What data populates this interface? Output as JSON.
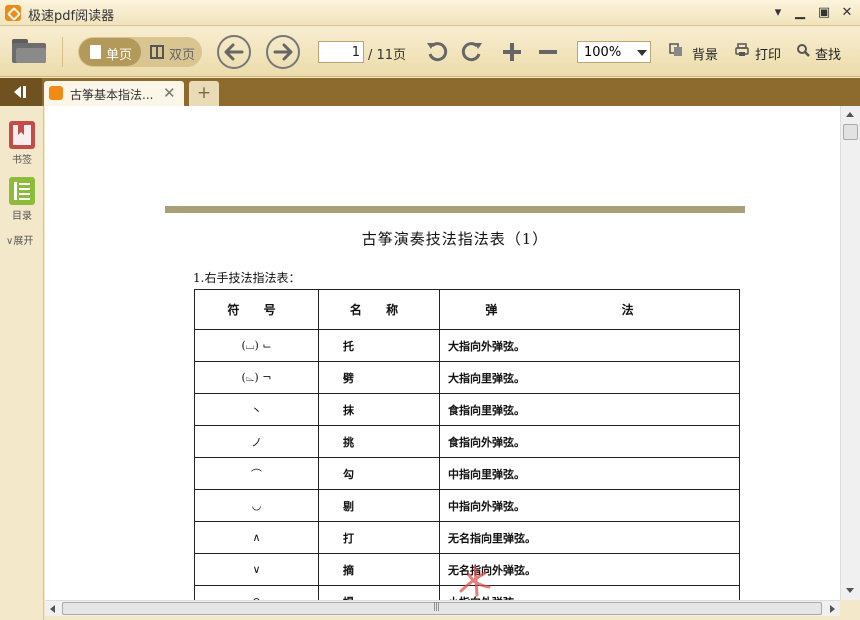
{
  "window": {
    "title": "极速pdf阅读器"
  },
  "toolbar": {
    "single_page_label": "单页",
    "double_page_label": "双页",
    "current_page": "1",
    "page_total": "/ 11页",
    "zoom": "100%",
    "background_label": "背景",
    "print_label": "打印",
    "find_label": "查找"
  },
  "tabs": [
    {
      "label": "古筝基本指法..."
    }
  ],
  "sidebar": {
    "bookmarks_label": "书签",
    "toc_label": "目录",
    "expand_label": "展开"
  },
  "document": {
    "title": "古筝演奏技法指法表（1）",
    "subtitle": "1.右手技法指法表：",
    "table": {
      "headers": [
        "符 号",
        "名 称",
        "弹 法"
      ],
      "rows": [
        {
          "symbol": "(⌴) ⌙",
          "name": "托",
          "method": "大指向外弹弦。"
        },
        {
          "symbol": "(⌳) ¬",
          "name": "劈",
          "method": "大指向里弹弦。"
        },
        {
          "symbol": "丶",
          "name": "抹",
          "method": "食指向里弹弦。"
        },
        {
          "symbol": "ノ",
          "name": "挑",
          "method": "食指向外弹弦。"
        },
        {
          "symbol": "⌒",
          "name": "勾",
          "method": "中指向里弹弦。"
        },
        {
          "symbol": "◡",
          "name": "剔",
          "method": "中指向外弹弦。"
        },
        {
          "symbol": "∧",
          "name": "打",
          "method": "无名指向里弹弦。"
        },
        {
          "symbol": "∨",
          "name": "摘",
          "method": "无名指向外弹弦。"
        },
        {
          "symbol": "∩",
          "name": "提",
          "method": "小指向外弹弦。"
        }
      ]
    }
  },
  "colors": {
    "accent": "#f08a12",
    "tabbar": "#8d6a2d",
    "toolbar": "#f1e3bd",
    "stamp": "#e05050"
  }
}
